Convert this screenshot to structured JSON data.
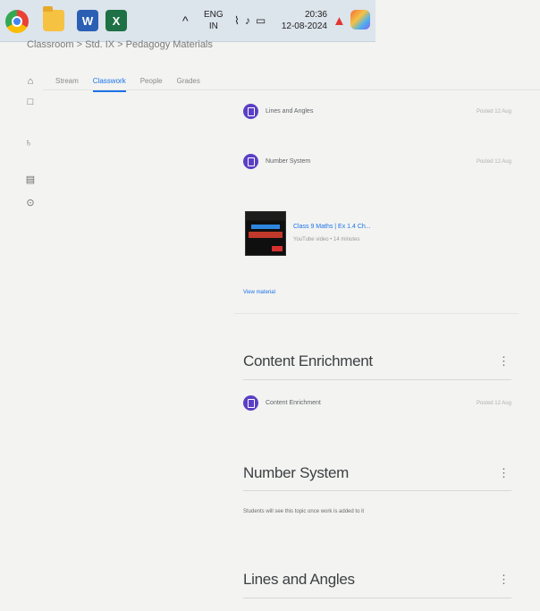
{
  "taskbar": {
    "lang_top": "ENG",
    "lang_bottom": "IN",
    "time": "20:36",
    "date": "12-08-2024",
    "icons": [
      "chrome-icon",
      "folder-icon",
      "word-icon",
      "excel-icon",
      "chevron-up-icon",
      "wifi-icon",
      "volume-icon",
      "battery-icon",
      "bell-icon",
      "copilot-icon"
    ],
    "word_letter": "W",
    "excel_letter": "X"
  },
  "breadcrumb": {
    "text": "Classroom  >  Std. IX  >  Pedagogy Materials"
  },
  "tabs": [
    {
      "label": "Stream"
    },
    {
      "label": "Classwork"
    },
    {
      "label": "People"
    },
    {
      "label": "Grades"
    }
  ],
  "materials": {
    "items": [
      {
        "label": "Lines and Angles",
        "date": "Posted 12 Aug"
      },
      {
        "label": "Number System",
        "date": "Posted 12 Aug"
      }
    ],
    "video": {
      "title": "Class 9 Maths | Ex 1.4 Ch...",
      "subtitle": "YouTube video • 14 minutes"
    },
    "view_material": "View material"
  },
  "topics": [
    {
      "title": "Content Enrichment",
      "item": {
        "label": "Content Enrichment",
        "date": "Posted 12 Aug"
      }
    },
    {
      "title": "Number System",
      "note": "Students will see this topic once work is added to it"
    },
    {
      "title": "Lines and Angles"
    }
  ],
  "kebab": "⋮",
  "accent": "#1a73e8",
  "material_icon_color": "#5b3fc4"
}
